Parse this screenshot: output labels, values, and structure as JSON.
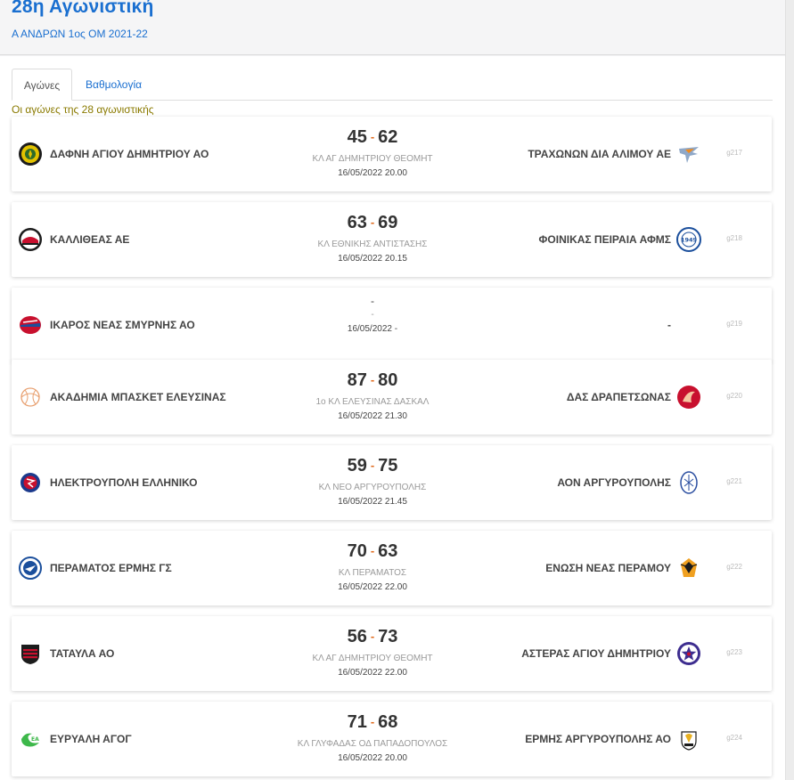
{
  "header": {
    "title": "28η Αγωνιστική",
    "subtitle": "Α ΑΝΔΡΩΝ 1ος ΟΜ 2021-22"
  },
  "tabs": [
    {
      "label": "Αγώνες",
      "active": true
    },
    {
      "label": "Βαθμολογία",
      "active": false
    }
  ],
  "round_note": "Οι αγώνες της 28 αγωνιστικής",
  "matches": [
    {
      "home": "ΔΑΦΝΗ ΑΓΙΟΥ ΔΗΜΗΤΡΙΟΥ ΑΟ",
      "home_score": "45",
      "sep": "-",
      "away_score": "62",
      "away": "ΤΡΑΧΩΝΩΝ ΔΙΑ ΑΛΙΜΟΥ ΑΕ",
      "venue": "ΚΛ ΑΓ ΔΗΜΗΤΡΙΟΥ ΘΕΟΜΗΤ",
      "datetime": "16/05/2022 20.00",
      "code": "g217",
      "home_icon": "daphne-crest-icon",
      "away_icon": "trachones-eagle-icon"
    },
    {
      "home": "ΚΑΛΛΙΘΕΑΣ ΑΕ",
      "home_score": "63",
      "sep": "-",
      "away_score": "69",
      "away": "ΦΟΙΝΙΚΑΣ ΠΕΙΡΑΙΑ ΑΦΜΣ",
      "venue": "ΚΛ ΕΘΝΙΚΗΣ ΑΝΤΙΣΤΑΣΗΣ",
      "datetime": "16/05/2022 20.15",
      "code": "g218",
      "home_icon": "kallithea-crest-icon",
      "away_icon": "phoenix-1949-crest-icon"
    },
    {
      "home": "ΙΚΑΡΟΣ ΝΕΑΣ ΣΜΥΡΝΗΣ ΑΟ",
      "home_score": "-",
      "sep": "",
      "away_score": "",
      "away": "-",
      "venue": "-",
      "datetime": "16/05/2022 -",
      "code": "g219",
      "home_icon": "ikaros-crest-icon",
      "away_icon": ""
    },
    {
      "home": "ΑΚΑΔΗΜΙΑ ΜΠΑΣΚΕΤ ΕΛΕΥΣΙΝΑΣ",
      "home_score": "87",
      "sep": "-",
      "away_score": "80",
      "away": "ΔΑΣ ΔΡΑΠΕΤΣΩΝΑΣ",
      "venue": "1ο ΚΛ ΕΛΕΥΣΙΝΑΣ ΔΑΣΚΑΛ",
      "datetime": "16/05/2022 21.30",
      "code": "g220",
      "home_icon": "academy-ball-icon",
      "away_icon": "drapetsona-crest-icon"
    },
    {
      "home": "ΗΛΕΚΤΡΟΥΠΟΛΗ ΕΛΛΗΝΙΚΟ",
      "home_score": "59",
      "sep": "-",
      "away_score": "75",
      "away": "ΑΟΝ ΑΡΓΥΡΟΥΠΟΛΗΣ",
      "venue": "ΚΛ ΝΕΟ ΑΡΓΥΡΟΥΠΟΛΗΣ",
      "datetime": "16/05/2022 21.45",
      "code": "g221",
      "home_icon": "ilektroupoli-crest-icon",
      "away_icon": "aon-crest-icon"
    },
    {
      "home": "ΠΕΡΑΜΑΤΟΣ ΕΡΜΗΣ ΓΣ",
      "home_score": "70",
      "sep": "-",
      "away_score": "63",
      "away": "ΕΝΩΣΗ ΝΕΑΣ ΠΕΡΑΜΟΥ",
      "venue": "ΚΛ ΠΕΡΑΜΑΤΟΣ",
      "datetime": "16/05/2022 22.00",
      "code": "g222",
      "home_icon": "perama-crest-icon",
      "away_icon": "eagle-shield-icon"
    },
    {
      "home": "ΤΑΤΑΥΛΑ ΑΟ",
      "home_score": "56",
      "sep": "-",
      "away_score": "73",
      "away": "ΑΣΤΕΡΑΣ ΑΓΙΟΥ ΔΗΜΗΤΡΙΟΥ",
      "venue": "ΚΛ ΑΓ ΔΗΜΗΤΡΙΟΥ ΘΕΟΜΗΤ",
      "datetime": "16/05/2022 22.00",
      "code": "g223",
      "home_icon": "tatavla-shield-icon",
      "away_icon": "star-crest-icon"
    },
    {
      "home": "ΕΥΡΥΑΛΗ ΑΓΟΓ",
      "home_score": "71",
      "sep": "-",
      "away_score": "68",
      "away": "ΕΡΜΗΣ ΑΡΓΥΡΟΥΠΟΛΗΣ ΑΟ",
      "venue": "ΚΛ ΓΛΥΦΑΔΑΣ ΟΔ ΠΑΠΑΔΟΠΟΥΛΟΣ",
      "datetime": "16/05/2022 20.00",
      "code": "g224",
      "home_icon": "evryali-crest-icon",
      "away_icon": "ermis-crest-icon"
    }
  ]
}
